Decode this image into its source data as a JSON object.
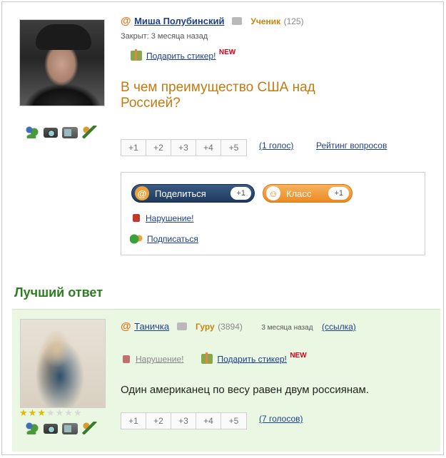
{
  "question": {
    "author": "Миша Полубинский",
    "rank": "Ученик",
    "rank_points": "(125)",
    "closed": "Закрыт: 3 месяца назад",
    "gift_label": "Подарить стикер!",
    "new_badge": "NEW",
    "title": "В чем преимущество США над Россией?",
    "votes": [
      "+1",
      "+2",
      "+3",
      "+4",
      "+5"
    ],
    "vote_count": "(1 голос)",
    "rating_link": "Рейтинг вопросов",
    "share": {
      "share_label": "Поделиться",
      "share_count": "+1",
      "class_label": "Класс",
      "class_count": "+1"
    },
    "violation": "Нарушение!",
    "subscribe": "Подписаться"
  },
  "best_answer_title": "Лучший ответ",
  "answer": {
    "author": "Таничка",
    "rank": "Гуру",
    "rank_points": "(3894)",
    "time": "3 месяца назад",
    "link": "(ссылка)",
    "violation": "Нарушение!",
    "gift_label": "Подарить стикер!",
    "new_badge": "NEW",
    "text": "Один американец по весу равен двум россиянам.",
    "votes": [
      "+1",
      "+2",
      "+3",
      "+4",
      "+5"
    ],
    "vote_count": "(7 голосов)",
    "stars_filled": 3,
    "stars_total": 7
  },
  "colors": {
    "accent_orange": "#e8731a",
    "link_blue": "#1e3f8c",
    "title_gold": "#c07a12",
    "best_green": "#2e7d23",
    "answer_bg": "#eaf7e2"
  }
}
